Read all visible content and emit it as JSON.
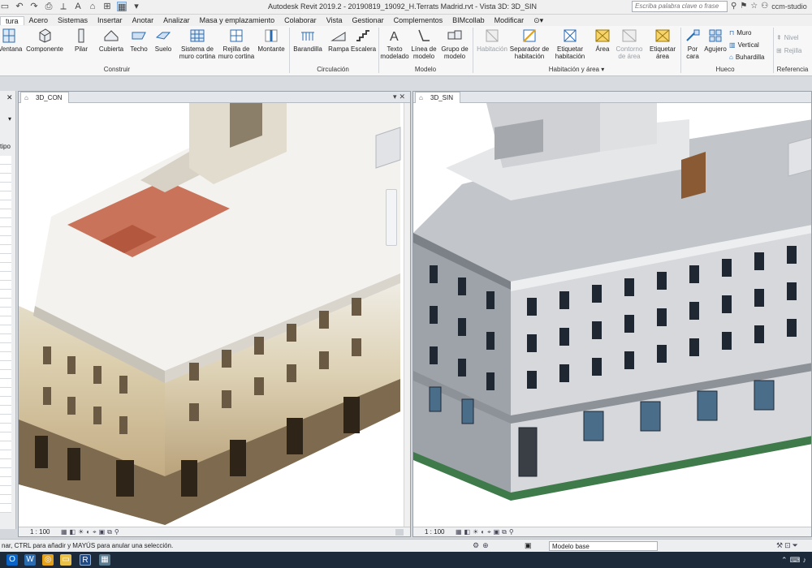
{
  "titlebar": {
    "title": "Autodesk Revit 2019.2 - 20190819_19092_H.Terrats Madrid.rvt - Vista 3D: 3D_SIN",
    "search_placeholder": "Escriba palabra clave o frase",
    "user": "ccm-studio"
  },
  "menu": [
    "tura",
    "Acero",
    "Sistemas",
    "Insertar",
    "Anotar",
    "Analizar",
    "Masa y emplazamiento",
    "Colaborar",
    "Vista",
    "Gestionar",
    "Complementos",
    "BIMcollab",
    "Modificar"
  ],
  "ribbon": {
    "tools": {
      "ventana": "Ventana",
      "componente": "Componente",
      "pilar": "Pilar",
      "cubierta": "Cubierta",
      "techo": "Techo",
      "suelo": "Suelo",
      "sistema_muro_cortina": "Sistema de muro cortina",
      "rejilla_muro_cortina": "Rejilla de muro cortina",
      "montante": "Montante",
      "barandilla": "Barandilla",
      "rampa": "Rampa",
      "escalera": "Escalera",
      "texto_modelado": "Texto modelado",
      "linea_modelo": "Línea de modelo",
      "grupo_modelo": "Grupo de modelo",
      "habitacion": "Habitación",
      "separador_habitacion": "Separador de habitación",
      "etiquetar_habitacion": "Etiquetar habitación",
      "area": "Área",
      "contorno_area": "Contorno de área",
      "etiquetar_area": "Etiquetar área",
      "por_cara": "Por cara",
      "agujero": "Agujero",
      "muro": "Muro",
      "vertical": "Vertical",
      "buhardilla": "Buhardilla",
      "nivel": "Nivel",
      "rejilla": "Rejilla"
    },
    "groups": {
      "construir": "Construir",
      "circulacion": "Circulación",
      "modelo": "Modelo",
      "habitacion_area": "Habitación y área ▾",
      "hueco": "Hueco",
      "referencia": "Referencia"
    }
  },
  "left_panel": {
    "label": "tipo"
  },
  "views": [
    {
      "name": "3D_CON",
      "scale": "1 : 100"
    },
    {
      "name": "3D_SIN",
      "scale": "1 : 100"
    }
  ],
  "status": {
    "message": "nar, CTRL para añadir y MAYÚS para anular una selección.",
    "model": "Modelo base"
  },
  "colors": {
    "accent": "#2b6cb0",
    "ribbon_bg": "#f7f7f7",
    "taskbar": "#1c2a3a"
  }
}
